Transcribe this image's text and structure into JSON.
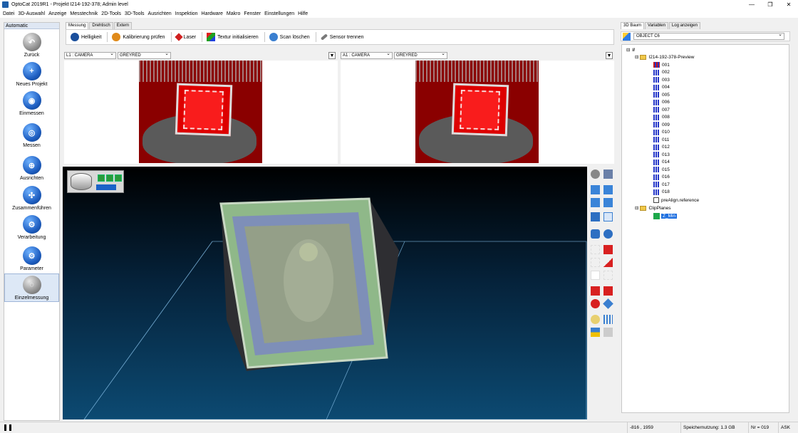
{
  "window": {
    "title": "OptoCat 2019R1 - Projekt I214-192-378; Admin level",
    "controls": [
      "—",
      "❐",
      "✕"
    ]
  },
  "menu": [
    "Datei",
    "3D-Auswahl",
    "Anzeige",
    "Messtechnik",
    "2D-Tools",
    "3D-Tools",
    "Ausrichten",
    "Inspektion",
    "Hardware",
    "Makro",
    "Fenster",
    "Einstellungen",
    "Hilfe"
  ],
  "left_panel": {
    "header": "Automatic",
    "items": [
      {
        "label": "Zurück",
        "icon": "back-arrow-icon"
      },
      {
        "label": "Neues Projekt",
        "icon": "new-project-icon"
      },
      {
        "label": "Einmessen",
        "icon": "calibrate-icon"
      },
      {
        "label": "Messen",
        "icon": "measure-icon"
      },
      {
        "label": "Ausrichten",
        "icon": "align-icon"
      },
      {
        "label": "Zusammenführen",
        "icon": "merge-icon"
      },
      {
        "label": "Verarbeitung",
        "icon": "processing-icon"
      },
      {
        "label": "Parameter",
        "icon": "gears-icon"
      },
      {
        "label": "Einzelmessung",
        "icon": "single-measure-icon"
      }
    ]
  },
  "center": {
    "tabs": [
      "Messung",
      "Drehtisch",
      "Extern"
    ],
    "toolbar": [
      {
        "label": "Helligkeit",
        "color": "#1a4f9c"
      },
      {
        "label": "Kalibrierung prüfen",
        "color": "#e08a1a"
      },
      {
        "label": "Laser",
        "color": "#d02020"
      },
      {
        "label": "Textur initialisieren",
        "color": "#2aa02a"
      },
      {
        "label": "Scan löschen",
        "color": "#3a7fd0"
      },
      {
        "label": "Sensor trennen",
        "color": "#7a7a7a"
      }
    ],
    "camera_left": {
      "camera": "L1 : CAMERA",
      "mode": "GREYRED"
    },
    "camera_right": {
      "camera": "A1 : CAMERA",
      "mode": "GREYRED"
    }
  },
  "right_panel": {
    "tabs": [
      "3D Baum",
      "Variablen",
      "Log anzeigen"
    ],
    "object": "OBJECT C6",
    "tree": {
      "root": "//",
      "project": "I214-192-378-Preview",
      "scans": [
        "001",
        "002",
        "003",
        "004",
        "005",
        "006",
        "007",
        "008",
        "009",
        "010",
        "011",
        "012",
        "013",
        "014",
        "015",
        "016",
        "017",
        "018"
      ],
      "reference": "preAlign.reference",
      "clip_folder": "ClipPlanes",
      "clip_item": "Z_Min"
    }
  },
  "status": {
    "coords": "-816 , 1959",
    "memory": "Speichernutzung: 1.3 GB",
    "number": "Nr = 019",
    "mode": "ASK"
  }
}
